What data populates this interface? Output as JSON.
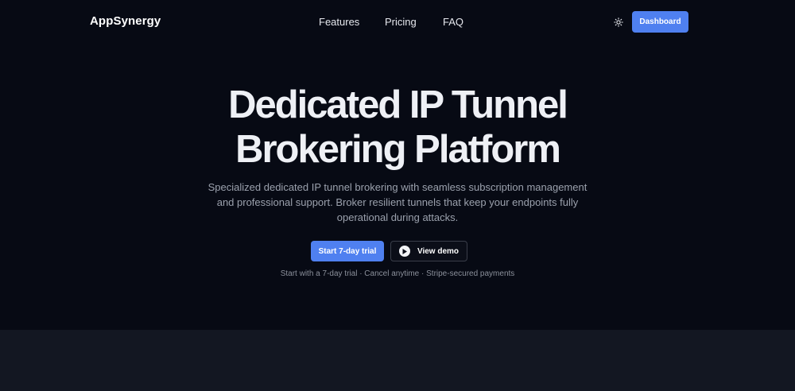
{
  "header": {
    "brand": "AppSynergy",
    "nav": [
      "Features",
      "Pricing",
      "FAQ"
    ],
    "theme_toggle_icon": "sun-icon",
    "dashboard_label": "Dashboard"
  },
  "hero": {
    "title_line1": "Dedicated IP Tunnel",
    "title_line2": "Brokering Platform",
    "subtitle": "Specialized dedicated IP tunnel brokering with seamless subscription management and professional support. Broker resilient tunnels that keep your endpoints fully operational during attacks.",
    "primary_cta": "Start 7-day trial",
    "secondary_cta": "View demo",
    "secondary_cta_icon": "play-icon",
    "fine_print": "Start with a 7-day trial · Cancel anytime · Stripe-secured payments"
  },
  "colors": {
    "background": "#070a14",
    "accent": "#4f80f0",
    "lower_section": "#131722"
  }
}
